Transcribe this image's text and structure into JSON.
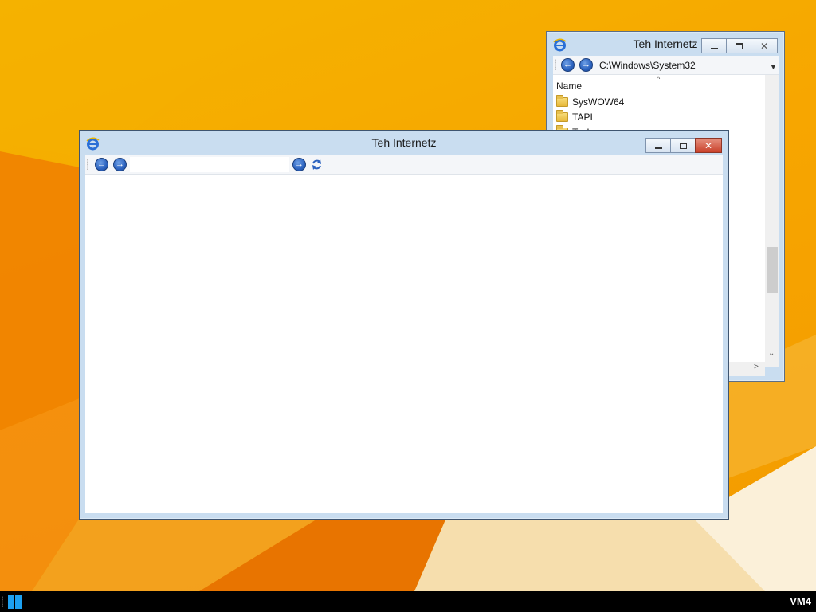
{
  "desktop": {
    "accent": "#f5a800"
  },
  "explorer_window": {
    "title": "Teh Internetz",
    "path": "C:\\Windows\\System32",
    "column_header": "Name",
    "items": [
      {
        "label": "SysWOW64",
        "icon": "folder-icon"
      },
      {
        "label": "TAPI",
        "icon": "folder-icon"
      },
      {
        "label": "Tasks",
        "icon": "folder-icon"
      }
    ]
  },
  "browser_window": {
    "title": "Teh Internetz",
    "address_value": ""
  },
  "taskbar": {
    "vm_label": "VM4"
  },
  "colors": {
    "close_button": "#c9412b",
    "start_logo": "#1da1f2",
    "nav_button": "#2b62bf"
  }
}
